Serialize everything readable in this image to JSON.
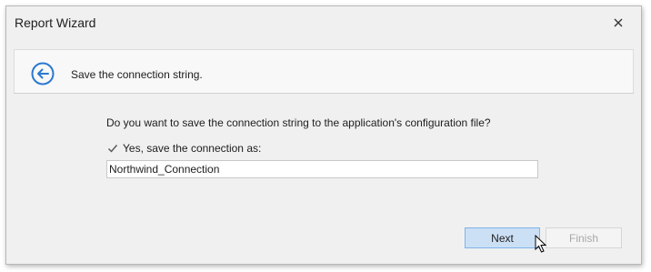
{
  "window": {
    "title": "Report Wizard",
    "close_icon": "close-icon"
  },
  "header": {
    "back_icon": "back-arrow-icon",
    "step_title": "Save the connection string."
  },
  "body": {
    "question": "Do you want to save the connection string to the application's configuration file?",
    "save_checkbox": {
      "label": "Yes, save the connection as:",
      "checked": true
    },
    "connection_name": "Northwind_Connection"
  },
  "footer": {
    "next_label": "Next",
    "finish_label": "Finish",
    "finish_enabled": false
  },
  "colors": {
    "accent": "#2b79d0",
    "next_bg": "#cce0f5",
    "next_border": "#7eb4ea",
    "disabled_text": "#a8a8a8"
  }
}
